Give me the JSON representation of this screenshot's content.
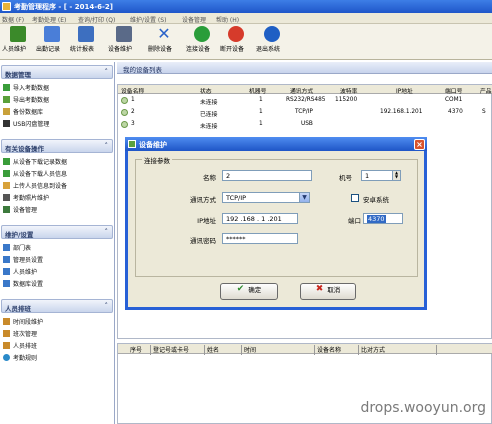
{
  "titlebar": {
    "title": "考勤管理程序 - [ - 2014-6-2]"
  },
  "menu": [
    "数据 (F)",
    "考勤处理 (E)",
    "查询/打印 (Q)",
    "维护/设置 (S)",
    "设备管理",
    "帮助 (H)"
  ],
  "toolbar": [
    {
      "label": "人员维护",
      "icon": "users-icon",
      "color": "#3b8a2a"
    },
    {
      "label": "出勤记录",
      "icon": "clock-doc-icon",
      "color": "#4a7ed8"
    },
    {
      "label": "统计报表",
      "icon": "report-icon",
      "color": "#3d6fc0"
    },
    {
      "label": "设备维护",
      "icon": "device-icon",
      "color": "#5a6a88"
    },
    {
      "label": "删除设备",
      "icon": "delete-icon",
      "color": "#2b63c9"
    },
    {
      "label": "连接设备",
      "icon": "connect-icon",
      "color": "#2a9d3a"
    },
    {
      "label": "断开设备",
      "icon": "disconnect-icon",
      "color": "#d63b2b"
    },
    {
      "label": "退出系统",
      "icon": "power-icon",
      "color": "#1f5fc4"
    }
  ],
  "sidebar": {
    "sections": [
      {
        "title": "数据管理",
        "items": [
          "导入考勤数据",
          "导出考勤数据",
          "备份数据库",
          "USB闪盘管理"
        ]
      },
      {
        "title": "有关设备操作",
        "items": [
          "从设备下载记录数据",
          "从设备下载人员信息",
          "上传人员信息到设备",
          "考勤照片维护",
          "设备管理"
        ]
      },
      {
        "title": "维护/设置",
        "items": [
          "部门表",
          "管理员设置",
          "人员维护",
          "数据库设置"
        ]
      },
      {
        "title": "人员排班",
        "items": [
          "时间段维护",
          "班次管理",
          "人员排班",
          "考勤规则"
        ]
      }
    ]
  },
  "content": {
    "title": "我的设备列表"
  },
  "device_table": {
    "columns": [
      "设备名称",
      "状态",
      "机器号",
      "通讯方式",
      "波特率",
      "IP地址",
      "端口号",
      "产品"
    ],
    "rows": [
      {
        "name": "1",
        "status": "未连接",
        "machine": "1",
        "comm": "RS232/RS485",
        "baud": "115200",
        "ip": "",
        "port": "COM1",
        "product": ""
      },
      {
        "name": "2",
        "status": "已连接",
        "machine": "1",
        "comm": "TCP/IP",
        "baud": "",
        "ip": "192.168.1.201",
        "port": "4370",
        "product": "S"
      },
      {
        "name": "3",
        "status": "未连接",
        "machine": "1",
        "comm": "USB",
        "baud": "",
        "ip": "",
        "port": "",
        "product": ""
      }
    ]
  },
  "record_table": {
    "columns": [
      "序号",
      "登记号或卡号",
      "姓名",
      "时间",
      "设备名称",
      "比对方式"
    ]
  },
  "dialog": {
    "title": "设备维护",
    "group_label": "连接参数",
    "name_label": "名称",
    "name_value": "2",
    "machine_label": "机号",
    "machine_value": "1",
    "comm_label": "通讯方式",
    "comm_value": "TCP/IP",
    "secure_label": "安卓系统",
    "ip_label": "IP地址",
    "ip_value": "192 .168 . 1 .201",
    "port_label": "端口",
    "port_value": "4370",
    "password_label": "通讯密码",
    "password_value": "******",
    "ok_label": "确定",
    "cancel_label": "取消"
  },
  "watermark": "drops.wooyun.org"
}
